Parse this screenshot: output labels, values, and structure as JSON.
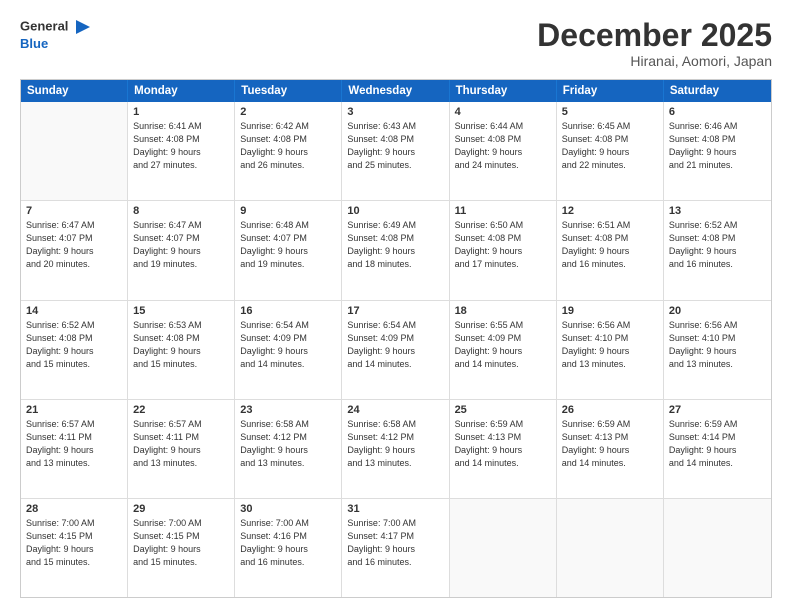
{
  "header": {
    "logo_line1": "General",
    "logo_line2": "Blue",
    "title": "December 2025",
    "subtitle": "Hiranai, Aomori, Japan"
  },
  "calendar": {
    "days_of_week": [
      "Sunday",
      "Monday",
      "Tuesday",
      "Wednesday",
      "Thursday",
      "Friday",
      "Saturday"
    ],
    "weeks": [
      [
        {
          "day": "",
          "info": ""
        },
        {
          "day": "1",
          "info": "Sunrise: 6:41 AM\nSunset: 4:08 PM\nDaylight: 9 hours\nand 27 minutes."
        },
        {
          "day": "2",
          "info": "Sunrise: 6:42 AM\nSunset: 4:08 PM\nDaylight: 9 hours\nand 26 minutes."
        },
        {
          "day": "3",
          "info": "Sunrise: 6:43 AM\nSunset: 4:08 PM\nDaylight: 9 hours\nand 25 minutes."
        },
        {
          "day": "4",
          "info": "Sunrise: 6:44 AM\nSunset: 4:08 PM\nDaylight: 9 hours\nand 24 minutes."
        },
        {
          "day": "5",
          "info": "Sunrise: 6:45 AM\nSunset: 4:08 PM\nDaylight: 9 hours\nand 22 minutes."
        },
        {
          "day": "6",
          "info": "Sunrise: 6:46 AM\nSunset: 4:08 PM\nDaylight: 9 hours\nand 21 minutes."
        }
      ],
      [
        {
          "day": "7",
          "info": "Sunrise: 6:47 AM\nSunset: 4:07 PM\nDaylight: 9 hours\nand 20 minutes."
        },
        {
          "day": "8",
          "info": "Sunrise: 6:47 AM\nSunset: 4:07 PM\nDaylight: 9 hours\nand 19 minutes."
        },
        {
          "day": "9",
          "info": "Sunrise: 6:48 AM\nSunset: 4:07 PM\nDaylight: 9 hours\nand 19 minutes."
        },
        {
          "day": "10",
          "info": "Sunrise: 6:49 AM\nSunset: 4:08 PM\nDaylight: 9 hours\nand 18 minutes."
        },
        {
          "day": "11",
          "info": "Sunrise: 6:50 AM\nSunset: 4:08 PM\nDaylight: 9 hours\nand 17 minutes."
        },
        {
          "day": "12",
          "info": "Sunrise: 6:51 AM\nSunset: 4:08 PM\nDaylight: 9 hours\nand 16 minutes."
        },
        {
          "day": "13",
          "info": "Sunrise: 6:52 AM\nSunset: 4:08 PM\nDaylight: 9 hours\nand 16 minutes."
        }
      ],
      [
        {
          "day": "14",
          "info": "Sunrise: 6:52 AM\nSunset: 4:08 PM\nDaylight: 9 hours\nand 15 minutes."
        },
        {
          "day": "15",
          "info": "Sunrise: 6:53 AM\nSunset: 4:08 PM\nDaylight: 9 hours\nand 15 minutes."
        },
        {
          "day": "16",
          "info": "Sunrise: 6:54 AM\nSunset: 4:09 PM\nDaylight: 9 hours\nand 14 minutes."
        },
        {
          "day": "17",
          "info": "Sunrise: 6:54 AM\nSunset: 4:09 PM\nDaylight: 9 hours\nand 14 minutes."
        },
        {
          "day": "18",
          "info": "Sunrise: 6:55 AM\nSunset: 4:09 PM\nDaylight: 9 hours\nand 14 minutes."
        },
        {
          "day": "19",
          "info": "Sunrise: 6:56 AM\nSunset: 4:10 PM\nDaylight: 9 hours\nand 13 minutes."
        },
        {
          "day": "20",
          "info": "Sunrise: 6:56 AM\nSunset: 4:10 PM\nDaylight: 9 hours\nand 13 minutes."
        }
      ],
      [
        {
          "day": "21",
          "info": "Sunrise: 6:57 AM\nSunset: 4:11 PM\nDaylight: 9 hours\nand 13 minutes."
        },
        {
          "day": "22",
          "info": "Sunrise: 6:57 AM\nSunset: 4:11 PM\nDaylight: 9 hours\nand 13 minutes."
        },
        {
          "day": "23",
          "info": "Sunrise: 6:58 AM\nSunset: 4:12 PM\nDaylight: 9 hours\nand 13 minutes."
        },
        {
          "day": "24",
          "info": "Sunrise: 6:58 AM\nSunset: 4:12 PM\nDaylight: 9 hours\nand 13 minutes."
        },
        {
          "day": "25",
          "info": "Sunrise: 6:59 AM\nSunset: 4:13 PM\nDaylight: 9 hours\nand 14 minutes."
        },
        {
          "day": "26",
          "info": "Sunrise: 6:59 AM\nSunset: 4:13 PM\nDaylight: 9 hours\nand 14 minutes."
        },
        {
          "day": "27",
          "info": "Sunrise: 6:59 AM\nSunset: 4:14 PM\nDaylight: 9 hours\nand 14 minutes."
        }
      ],
      [
        {
          "day": "28",
          "info": "Sunrise: 7:00 AM\nSunset: 4:15 PM\nDaylight: 9 hours\nand 15 minutes."
        },
        {
          "day": "29",
          "info": "Sunrise: 7:00 AM\nSunset: 4:15 PM\nDaylight: 9 hours\nand 15 minutes."
        },
        {
          "day": "30",
          "info": "Sunrise: 7:00 AM\nSunset: 4:16 PM\nDaylight: 9 hours\nand 16 minutes."
        },
        {
          "day": "31",
          "info": "Sunrise: 7:00 AM\nSunset: 4:17 PM\nDaylight: 9 hours\nand 16 minutes."
        },
        {
          "day": "",
          "info": ""
        },
        {
          "day": "",
          "info": ""
        },
        {
          "day": "",
          "info": ""
        }
      ]
    ]
  }
}
